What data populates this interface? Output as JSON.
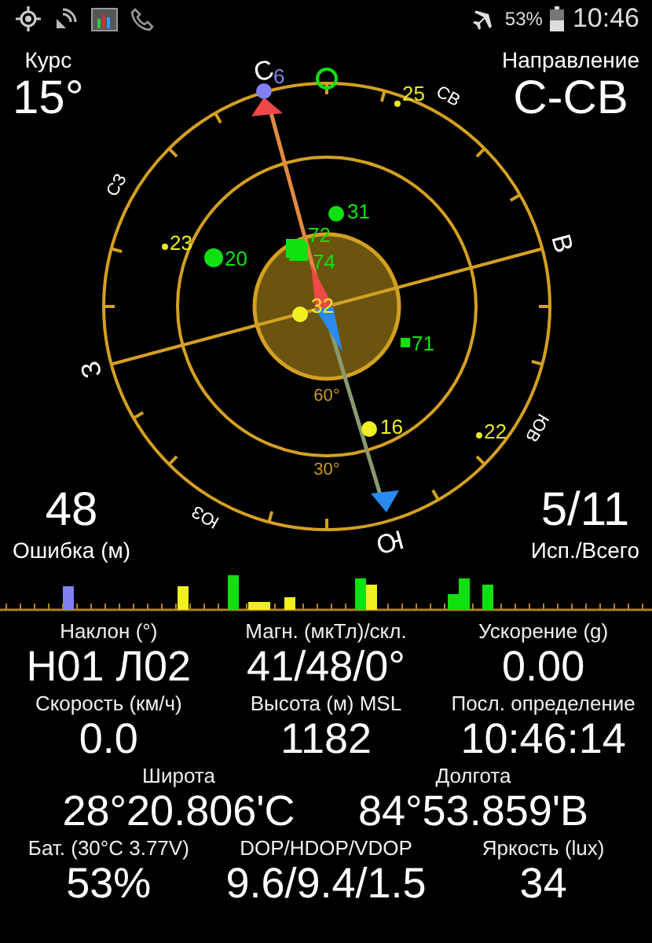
{
  "status_bar": {
    "battery": "53%",
    "time": "10:46"
  },
  "course": {
    "label": "Курс",
    "value": "15°"
  },
  "direction": {
    "label": "Направление",
    "value": "С-СВ"
  },
  "error": {
    "value": "48",
    "label": "Ошибка (м)"
  },
  "satellites_count": {
    "value": "5/11",
    "label": "Исп./Всего"
  },
  "sky_plot": {
    "compass_labels": [
      "С",
      "СВ",
      "В",
      "ЮВ",
      "Ю",
      "ЮЗ",
      "З",
      "СЗ"
    ],
    "ring_labels": [
      "60°",
      "30°"
    ],
    "satellites": [
      {
        "id": "6",
        "kind": "dot",
        "color": "#8080f0"
      },
      {
        "id": "25",
        "kind": "point",
        "color": "#e8e820"
      },
      {
        "id": "23",
        "kind": "point",
        "color": "#e8e820"
      },
      {
        "id": "20",
        "kind": "dot",
        "color": "#10e010"
      },
      {
        "id": "31",
        "kind": "dot",
        "color": "#10e010"
      },
      {
        "id": "72",
        "kind": "square",
        "color": "#10e010"
      },
      {
        "id": "74",
        "kind": "square",
        "color": "#10e010"
      },
      {
        "id": "32",
        "kind": "dot",
        "color": "#f0f020"
      },
      {
        "id": "71",
        "kind": "square",
        "color": "#10e010"
      },
      {
        "id": "16",
        "kind": "dot",
        "color": "#f0f020"
      },
      {
        "id": "22",
        "kind": "point",
        "color": "#e8e820"
      }
    ]
  },
  "readings": [
    [
      {
        "label": "Наклон (°)",
        "value": "Н01 Л02"
      },
      {
        "label": "Магн. (мкТл)/скл.",
        "value": "41/48/0°"
      },
      {
        "label": "Ускорение (g)",
        "value": "0.00"
      }
    ],
    [
      {
        "label": "Скорость (км/ч)",
        "value": "0.0"
      },
      {
        "label": "Высота (м) MSL",
        "value": "1182"
      },
      {
        "label": "Посл. определение",
        "value": "10:46:14"
      }
    ],
    [
      {
        "label": "Широта",
        "value": "28°20.806'С"
      },
      {
        "label": "Долгота",
        "value": "84°53.859'В"
      }
    ],
    [
      {
        "label": "Бат. (30°C 3.77V)",
        "value": "53%"
      },
      {
        "label": "DOP/HDOP/VDOP",
        "value": "9.6/9.4/1.5"
      },
      {
        "label": "Яркость (lux)",
        "value": "34"
      }
    ]
  ]
}
